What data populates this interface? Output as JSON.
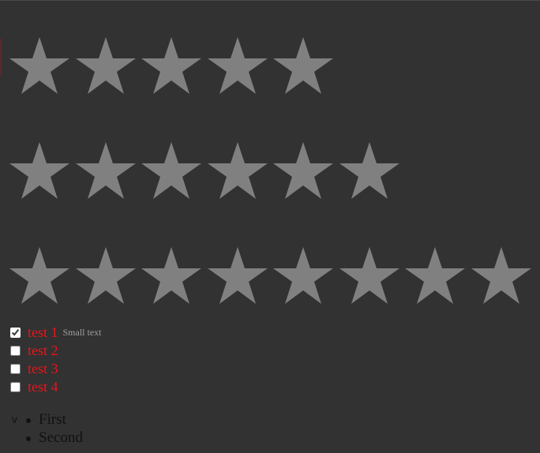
{
  "ratings": [
    {
      "stars": 5
    },
    {
      "stars": 6
    },
    {
      "stars": 8
    }
  ],
  "checklist": {
    "items": [
      {
        "label": "test 1",
        "checked": true,
        "note": "Small text"
      },
      {
        "label": "test 2",
        "checked": false
      },
      {
        "label": "test 3",
        "checked": false
      },
      {
        "label": "test 4",
        "checked": false
      }
    ]
  },
  "list": {
    "toggle_glyph": "v",
    "items": [
      "First",
      "Second"
    ]
  },
  "colors": {
    "background": "#323232",
    "star": "#808080",
    "label": "#e8161b",
    "small_text": "#a0a0a0",
    "list_text": "#111111"
  }
}
